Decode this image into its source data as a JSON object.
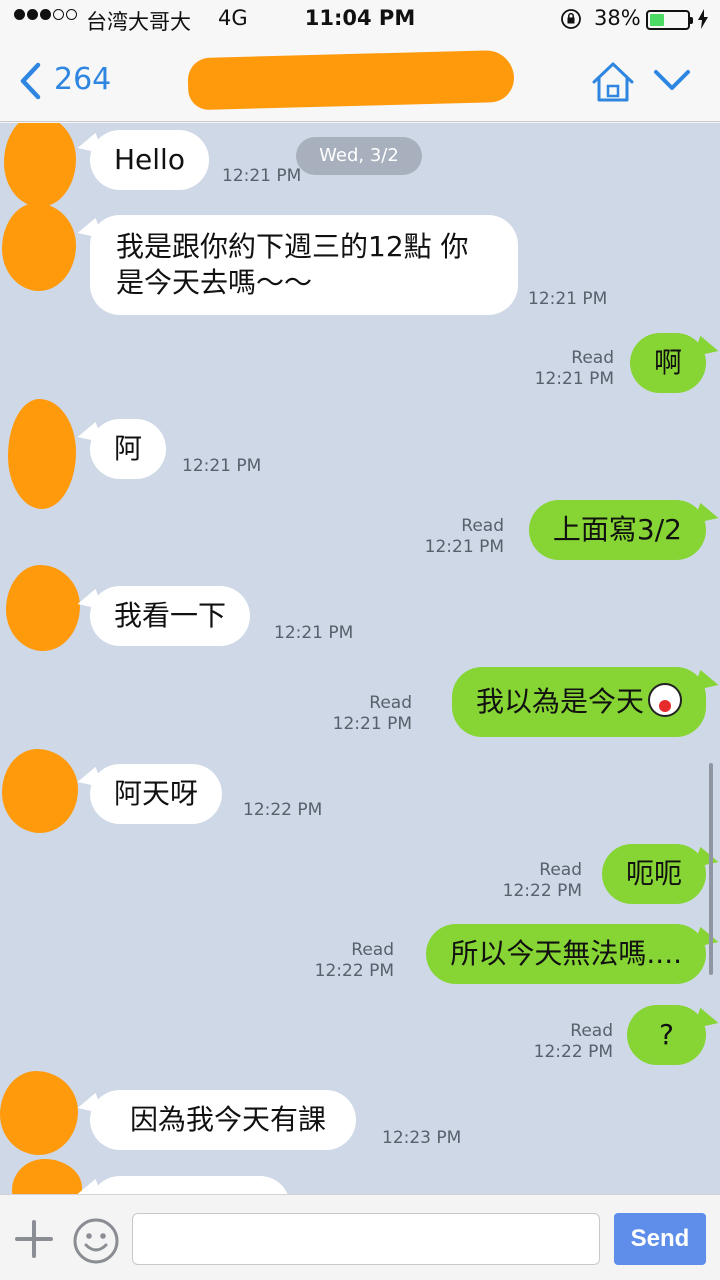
{
  "status_bar": {
    "signal_dots": "●●●○○",
    "carrier": "台湾大哥大",
    "network": "4G",
    "time": "11:04 PM",
    "battery_percent": "38%",
    "battery_level": 0.38
  },
  "nav": {
    "back_count": "264",
    "icons": [
      "chevron-left-icon",
      "home-icon",
      "chevron-down-icon"
    ]
  },
  "chat": {
    "date_badge": "Wed, 3/2",
    "messages": [
      {
        "from": "other",
        "text": "Hello",
        "time": "12:21 PM"
      },
      {
        "from": "other",
        "text": "我是跟你約下週三的12點 你是今天去嗎～～",
        "time": "12:21 PM"
      },
      {
        "from": "me",
        "text": "啊",
        "status": "Read",
        "time": "12:21 PM"
      },
      {
        "from": "other",
        "text": "阿",
        "time": "12:21 PM"
      },
      {
        "from": "me",
        "text": "上面寫3/2",
        "status": "Read",
        "time": "12:21 PM"
      },
      {
        "from": "other",
        "text": "我看一下",
        "time": "12:21 PM"
      },
      {
        "from": "me",
        "text": "我以為是今天",
        "status": "Read",
        "time": "12:21 PM",
        "emoji": "laughing-face-icon"
      },
      {
        "from": "other",
        "text": "阿天呀",
        "time": "12:22 PM"
      },
      {
        "from": "me",
        "text": "呃呃",
        "status": "Read",
        "time": "12:22 PM"
      },
      {
        "from": "me",
        "text": "所以今天無法嗎....",
        "status": "Read",
        "time": "12:22 PM"
      },
      {
        "from": "me",
        "text": "?",
        "status": "Read",
        "time": "12:22 PM"
      },
      {
        "from": "other",
        "text": "因為我今天有課",
        "time": "12:23 PM"
      }
    ]
  },
  "input_bar": {
    "placeholder": "",
    "send_label": "Send"
  },
  "colors": {
    "chat_background": "#cfd8e6",
    "outgoing_bubble": "#86d534",
    "incoming_bubble": "#ffffff",
    "accent": "#2e86e0",
    "send_button": "#5e8ee9",
    "redaction": "#ff9a0d"
  }
}
